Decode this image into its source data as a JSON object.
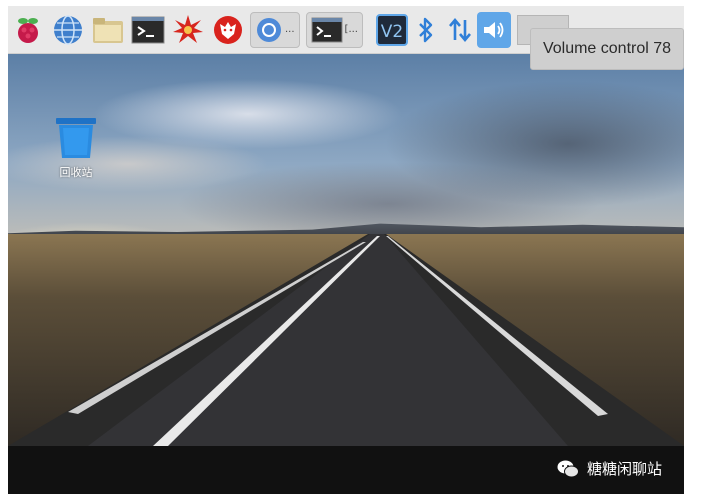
{
  "taskbar": {
    "launchers": [
      {
        "icon": "raspberry-menu-icon"
      },
      {
        "icon": "web-browser-icon"
      },
      {
        "icon": "file-manager-icon"
      },
      {
        "icon": "terminal-icon"
      },
      {
        "icon": "mathematica-icon"
      },
      {
        "icon": "wolfram-icon"
      }
    ],
    "tasks": [
      {
        "icon": "chromium-icon",
        "label": "..."
      },
      {
        "icon": "terminal-icon",
        "label": "[..."
      }
    ],
    "tray": [
      {
        "icon": "vnc-icon",
        "label": "V2"
      },
      {
        "icon": "bluetooth-icon"
      },
      {
        "icon": "network-icon"
      },
      {
        "icon": "volume-icon"
      }
    ]
  },
  "tooltip": {
    "text": "Volume control 78"
  },
  "desktop": {
    "trash_label": "回收站"
  },
  "watermark": {
    "text": "糖糖闲聊站"
  },
  "colors": {
    "accent": "#5fa6e8",
    "taskbar": "#e9e9e9"
  }
}
